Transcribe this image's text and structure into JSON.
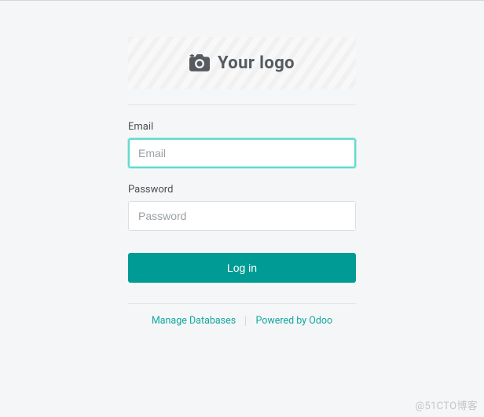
{
  "logo": {
    "text": "Your logo",
    "icon": "camera-add-icon"
  },
  "form": {
    "email": {
      "label": "Email",
      "placeholder": "Email",
      "value": ""
    },
    "password": {
      "label": "Password",
      "placeholder": "Password",
      "value": ""
    },
    "submit_label": "Log in"
  },
  "footer": {
    "manage_db": "Manage Databases",
    "powered_by": "Powered by Odoo"
  },
  "watermark": "@51CTO博客"
}
